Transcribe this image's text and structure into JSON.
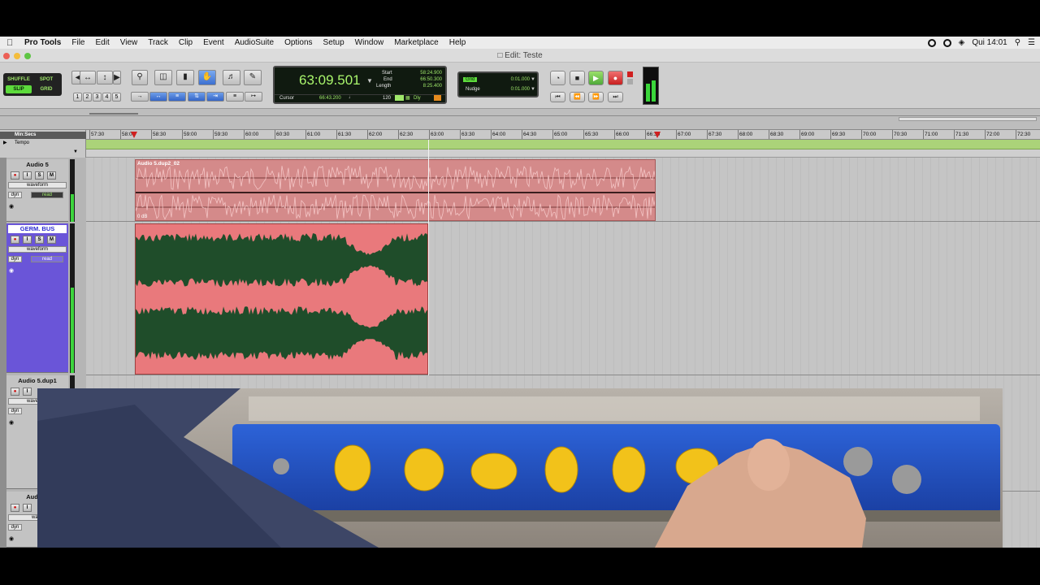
{
  "menubar": {
    "app": "Pro Tools",
    "items": [
      "File",
      "Edit",
      "View",
      "Track",
      "Clip",
      "Event",
      "AudioSuite",
      "Options",
      "Setup",
      "Window",
      "Marketplace",
      "Help"
    ],
    "clock": "Qui 14:01"
  },
  "window": {
    "title": "Edit: Teste"
  },
  "modes": {
    "shuffle": "SHUFFLE",
    "spot": "SPOT",
    "slip": "SLIP",
    "grid": "GRID"
  },
  "zoom_presets": [
    "1",
    "2",
    "3",
    "4",
    "5"
  ],
  "counter": {
    "main": "63:09.501",
    "start_label": "Start",
    "start": "58:24.900",
    "end_label": "End",
    "end": "66:50.300",
    "length_label": "Length",
    "length": "8:25.400",
    "cursor_label": "Cursor",
    "cursor": "66:43.200",
    "tempo": "120",
    "dly": "Dly"
  },
  "grid": {
    "label": "Grid",
    "value": "0:01.000"
  },
  "nudge": {
    "label": "Nudge",
    "value": "0:01.000"
  },
  "ruler": {
    "label": "Min:Secs",
    "tempo_label": "Tempo",
    "ticks": [
      "57:30",
      "58:00",
      "58:30",
      "59:00",
      "59:30",
      "60:00",
      "60:30",
      "61:00",
      "61:30",
      "62:00",
      "62:30",
      "63:00",
      "63:30",
      "64:00",
      "64:30",
      "65:00",
      "65:30",
      "66:00",
      "66:30",
      "67:00",
      "67:30",
      "68:00",
      "68:30",
      "69:00",
      "69:30",
      "70:00",
      "70:30",
      "71:00",
      "71:30",
      "72:00",
      "72:30"
    ]
  },
  "tracks": [
    {
      "name": "Audio 5",
      "view": "waveform",
      "auto": "dyn",
      "mode": "read",
      "clip": "Audio 5.dup2_02",
      "gain": "0 dB"
    },
    {
      "name": "GERM. BUS",
      "view": "waveform",
      "auto": "dyn",
      "mode": "read"
    },
    {
      "name": "Audio 5.dup1",
      "view": "waveform",
      "auto": "dyn"
    },
    {
      "name": "Audio 5",
      "view": "wave",
      "auto": "dyn"
    }
  ],
  "colors": {
    "clip_pink": "#d97b7b",
    "wave_green": "#1f4d2a",
    "counter_green": "#a9f56c",
    "selected_track": "#6a55d8"
  }
}
